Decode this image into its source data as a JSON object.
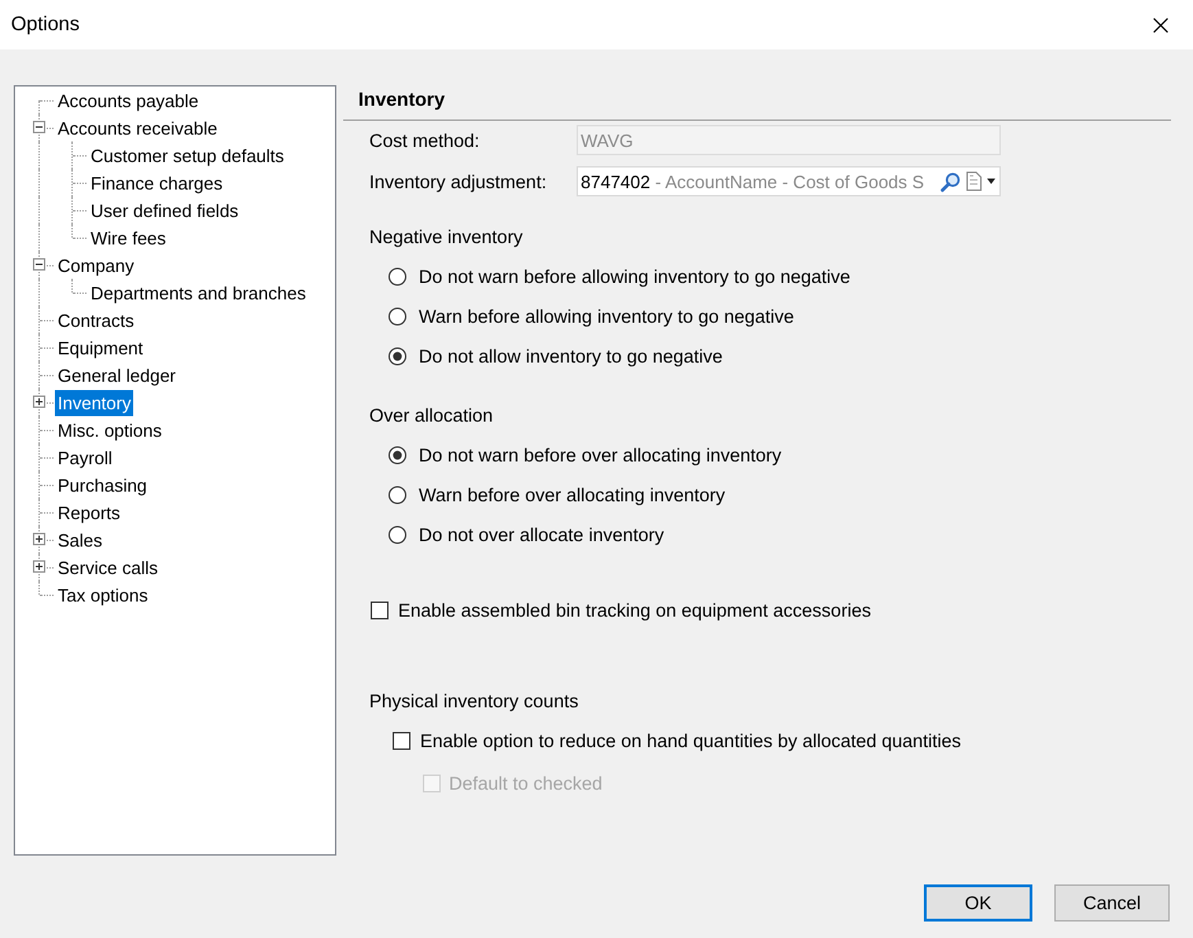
{
  "window": {
    "title": "Options"
  },
  "tree": {
    "items": [
      {
        "label": "Accounts payable",
        "selected": false
      },
      {
        "label": "Accounts receivable",
        "selected": false,
        "expanded": true,
        "children": [
          {
            "label": "Customer setup defaults",
            "selected": false
          },
          {
            "label": "Finance charges",
            "selected": false
          },
          {
            "label": "User defined fields",
            "selected": false
          },
          {
            "label": "Wire fees",
            "selected": false
          }
        ]
      },
      {
        "label": "Company",
        "selected": false,
        "expanded": true,
        "children": [
          {
            "label": "Departments and branches",
            "selected": false
          }
        ]
      },
      {
        "label": "Contracts",
        "selected": false
      },
      {
        "label": "Equipment",
        "selected": false
      },
      {
        "label": "General ledger",
        "selected": false
      },
      {
        "label": "Inventory",
        "selected": true,
        "expanded": false
      },
      {
        "label": "Misc. options",
        "selected": false
      },
      {
        "label": "Payroll",
        "selected": false
      },
      {
        "label": "Purchasing",
        "selected": false
      },
      {
        "label": "Reports",
        "selected": false
      },
      {
        "label": "Sales",
        "selected": false,
        "expanded": false
      },
      {
        "label": "Service calls",
        "selected": false,
        "expanded": false
      },
      {
        "label": "Tax options",
        "selected": false
      }
    ]
  },
  "panel": {
    "title": "Inventory",
    "fields": [
      {
        "kind": "text",
        "label": "Cost method:",
        "value": "WAVG",
        "disabled": true
      },
      {
        "kind": "lookup",
        "label": "Inventory adjustment:",
        "value": "8747402",
        "description": "- AccountName - Cost of Goods S",
        "disabled": false
      }
    ],
    "radio_groups": [
      {
        "title": "Negative inventory",
        "options": [
          {
            "label": "Do not warn before allowing inventory to go negative",
            "selected": false
          },
          {
            "label": "Warn before allowing inventory to go negative",
            "selected": false
          },
          {
            "label": "Do not allow inventory to go negative",
            "selected": true
          }
        ]
      },
      {
        "title": "Over allocation",
        "options": [
          {
            "label": "Do not warn before over allocating inventory",
            "selected": true
          },
          {
            "label": "Warn before over allocating inventory",
            "selected": false
          },
          {
            "label": "Do not over allocate inventory",
            "selected": false
          }
        ]
      }
    ],
    "bin_tracking": {
      "label": "Enable assembled bin tracking on equipment accessories",
      "checked": false,
      "disabled": false
    },
    "physical_inventory_counts": {
      "title": "Physical inventory counts",
      "options": [
        {
          "label": "Enable option to reduce on hand quantities by allocated quantities",
          "checked": false,
          "disabled": false,
          "children": [
            {
              "label": "Default to checked",
              "checked": false,
              "disabled": true
            }
          ]
        }
      ]
    }
  },
  "buttons": [
    {
      "label": "OK",
      "default": true
    },
    {
      "label": "Cancel",
      "default": false
    }
  ]
}
